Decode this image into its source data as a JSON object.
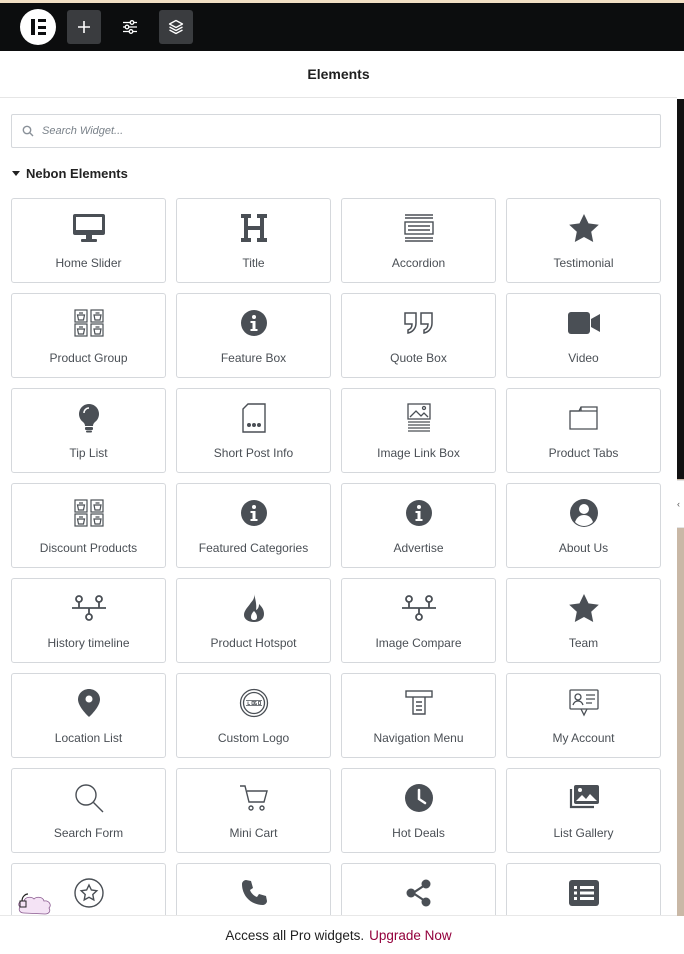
{
  "toolbar": {
    "logo": "elementor-logo-icon",
    "buttons": [
      {
        "name": "add-element-button",
        "icon": "plus-icon"
      },
      {
        "name": "site-settings-button",
        "icon": "sliders-icon"
      },
      {
        "name": "structure-button",
        "icon": "layers-icon"
      }
    ]
  },
  "panel": {
    "title": "Elements",
    "search": {
      "placeholder": "Search Widget...",
      "value": ""
    },
    "category": "Nebon Elements",
    "widgets": [
      {
        "label": "Home Slider",
        "icon": "desktop-icon"
      },
      {
        "label": "Title",
        "icon": "heading-icon"
      },
      {
        "label": "Accordion",
        "icon": "accordion-icon"
      },
      {
        "label": "Testimonial",
        "icon": "star-icon"
      },
      {
        "label": "Product Group",
        "icon": "products-icon"
      },
      {
        "label": "Feature Box",
        "icon": "info-circle-icon"
      },
      {
        "label": "Quote Box",
        "icon": "quote-icon"
      },
      {
        "label": "Video",
        "icon": "video-camera-icon"
      },
      {
        "label": "Tip List",
        "icon": "lightbulb-icon"
      },
      {
        "label": "Short Post Info",
        "icon": "post-info-icon"
      },
      {
        "label": "Image Link Box",
        "icon": "image-box-icon"
      },
      {
        "label": "Product Tabs",
        "icon": "folder-tab-icon"
      },
      {
        "label": "Discount Products",
        "icon": "products-icon"
      },
      {
        "label": "Featured Categories",
        "icon": "info-circle-icon"
      },
      {
        "label": "Advertise",
        "icon": "info-circle-icon"
      },
      {
        "label": "About Us",
        "icon": "user-circle-icon"
      },
      {
        "label": "History timeline",
        "icon": "timeline-icon"
      },
      {
        "label": "Product Hotspot",
        "icon": "fire-icon"
      },
      {
        "label": "Image Compare",
        "icon": "timeline-icon"
      },
      {
        "label": "Team",
        "icon": "star-icon"
      },
      {
        "label": "Location List",
        "icon": "map-pin-icon"
      },
      {
        "label": "Custom Logo",
        "icon": "logo-badge-icon"
      },
      {
        "label": "Navigation Menu",
        "icon": "nav-menu-icon"
      },
      {
        "label": "My Account",
        "icon": "account-card-icon"
      },
      {
        "label": "Search Form",
        "icon": "magnifier-icon"
      },
      {
        "label": "Mini Cart",
        "icon": "cart-icon"
      },
      {
        "label": "Hot Deals",
        "icon": "clock-icon"
      },
      {
        "label": "List Gallery",
        "icon": "gallery-icon"
      },
      {
        "label": "",
        "icon": "star-outline-circle-icon"
      },
      {
        "label": "",
        "icon": "phone-icon"
      },
      {
        "label": "",
        "icon": "share-icon"
      },
      {
        "label": "",
        "icon": "list-icon"
      }
    ]
  },
  "promo": {
    "text": "Access all Pro widgets.",
    "link": "Upgrade Now"
  },
  "colors": {
    "toolbar_bg": "#0c0d0e",
    "icon": "#4a4f55",
    "link": "#93003c",
    "tile_border": "#d5d8dc"
  }
}
